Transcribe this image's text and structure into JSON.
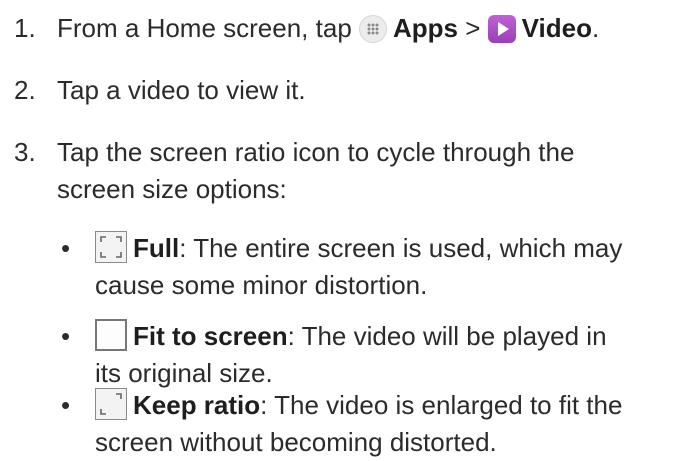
{
  "steps": [
    {
      "num": "1.",
      "pre": "From a Home screen, tap ",
      "apps": "Apps",
      "sep": " > ",
      "video": "Video",
      "end": "."
    },
    {
      "num": "2.",
      "text": "Tap a video to view it."
    },
    {
      "num": "3.",
      "text_line1": "Tap the screen ratio icon to cycle through the",
      "text_line2": "screen size options:"
    }
  ],
  "options": [
    {
      "bullet": "•",
      "label": "Full",
      "line1": ": The entire screen is used, which may",
      "line2": "cause some minor distortion.",
      "icon": "full-screen-icon"
    },
    {
      "bullet": "•",
      "label": "Fit to screen",
      "line1": ": The video will be played in",
      "line2": "its original size.",
      "icon": "fit-screen-icon"
    },
    {
      "bullet": "•",
      "label": "Keep ratio",
      "line1": ": The video is enlarged to fit the",
      "line2": "screen without becoming distorted.",
      "icon": "keep-ratio-icon"
    }
  ],
  "colors": {
    "video_icon": "#b04fcf",
    "text": "#2b2b2b"
  }
}
